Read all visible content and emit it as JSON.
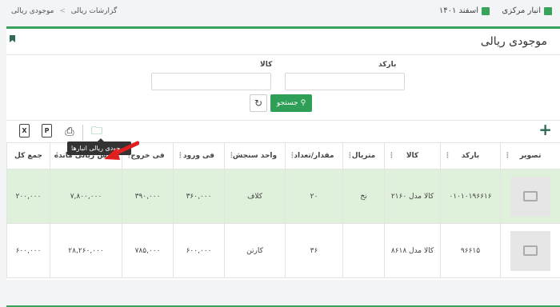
{
  "breadcrumb": {
    "parent": "گزارشات ریالی",
    "separator": ">",
    "current": "موجودی ریالی"
  },
  "header": {
    "warehouse": "انبار مرکزی",
    "date": "اسفند ۱۴۰۱"
  },
  "page": {
    "title": "موجودی ریالی"
  },
  "filters": {
    "barcode_label": "بارکد",
    "item_label": "کالا",
    "search_label": "جستجو"
  },
  "toolbar": {
    "excel": "X",
    "pdf": "P",
    "tooltip": "موجودی ریالی انبارها",
    "add": "+"
  },
  "table": {
    "headers": [
      "تصویر",
      "بارکد",
      "کالا",
      "متریال",
      "مقدار/تعداد",
      "واحد سنجش",
      "فی ورود",
      "فی خروج",
      "ارزش ریالی مانده",
      "جمع کل"
    ],
    "rows": [
      [
        "",
        "۰۱۰۱۰۱۹۶۶۱۶",
        "کالا مدل ۲۱۶۰",
        "نخ",
        "۲۰",
        "کلاف",
        "۳۶۰,۰۰۰",
        "۳۹۰,۰۰۰",
        "۷,۸۰۰,۰۰۰",
        "۲۰۰,۰۰۰"
      ],
      [
        "",
        "۹۶۶۱۵",
        "کالا مدل ۸۶۱۸",
        "",
        "۳۶",
        "کارتن",
        "۶۰۰,۰۰۰",
        "۷۸۵,۰۰۰",
        "۲۸,۲۶۰,۰۰۰",
        "۶۰۰,۰۰۰"
      ]
    ]
  },
  "colors": {
    "accent": "#3aa35b",
    "highlight_row": "#dff1db",
    "arrow": "#e02020"
  }
}
